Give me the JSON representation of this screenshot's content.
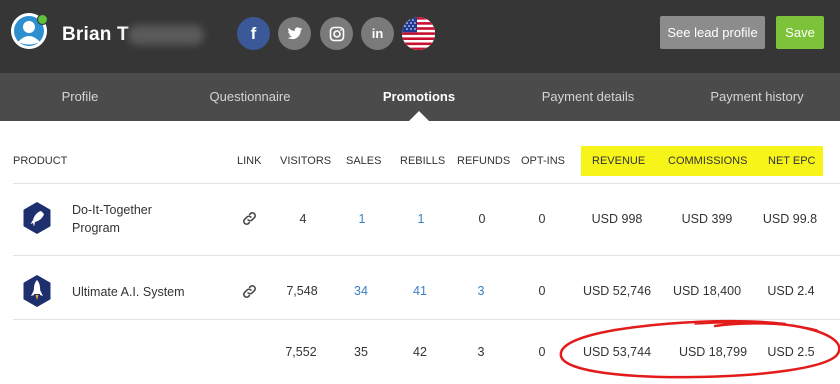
{
  "header": {
    "user_name": "Brian T",
    "see_lead_label": "See lead profile",
    "save_label": "Save",
    "social": [
      {
        "name": "facebook",
        "glyph": "f",
        "color": "#3b5998"
      },
      {
        "name": "twitter",
        "color": "#7a7a7a"
      },
      {
        "name": "instagram",
        "color": "#7a7a7a"
      },
      {
        "name": "linkedin",
        "glyph": "in",
        "color": "#7a7a7a"
      }
    ]
  },
  "tabs": [
    {
      "label": "Profile"
    },
    {
      "label": "Questionnaire"
    },
    {
      "label": "Promotions",
      "active": true
    },
    {
      "label": "Payment details"
    },
    {
      "label": "Payment history"
    }
  ],
  "table": {
    "headers": {
      "product": "PRODUCT",
      "link": "LINK",
      "visitors": "VISITORS",
      "sales": "SALES",
      "rebills": "REBILLS",
      "refunds": "REFUNDS",
      "optins": "OPT-INS",
      "revenue": "REVENUE",
      "commissions": "COMMISSIONS",
      "net_epc": "NET EPC"
    },
    "highlight_color": "#f7f41a",
    "rows": [
      {
        "product": "Do-It-Together Program",
        "product_line1": "Do-It-Together",
        "product_line2": "Program",
        "visitors": "4",
        "sales": "1",
        "rebills": "1",
        "refunds": "0",
        "optins": "0",
        "revenue": "USD 998",
        "commissions": "USD 399",
        "net_epc": "USD 99.8"
      },
      {
        "product": "Ultimate A.I. System",
        "visitors": "7,548",
        "sales": "34",
        "rebills": "41",
        "refunds": "3",
        "optins": "0",
        "revenue": "USD 52,746",
        "commissions": "USD 18,400",
        "net_epc": "USD 2.4"
      }
    ],
    "totals": {
      "visitors": "7,552",
      "sales": "35",
      "rebills": "42",
      "refunds": "3",
      "optins": "0",
      "revenue": "USD 53,744",
      "commissions": "USD 18,799",
      "net_epc": "USD 2.5"
    }
  },
  "colors": {
    "header_bg": "#363636",
    "tab_bg": "#4b4b4b",
    "link_blue": "#3a7fc4",
    "save_green": "#7dc33a",
    "annotation_red": "#e31b1b"
  }
}
